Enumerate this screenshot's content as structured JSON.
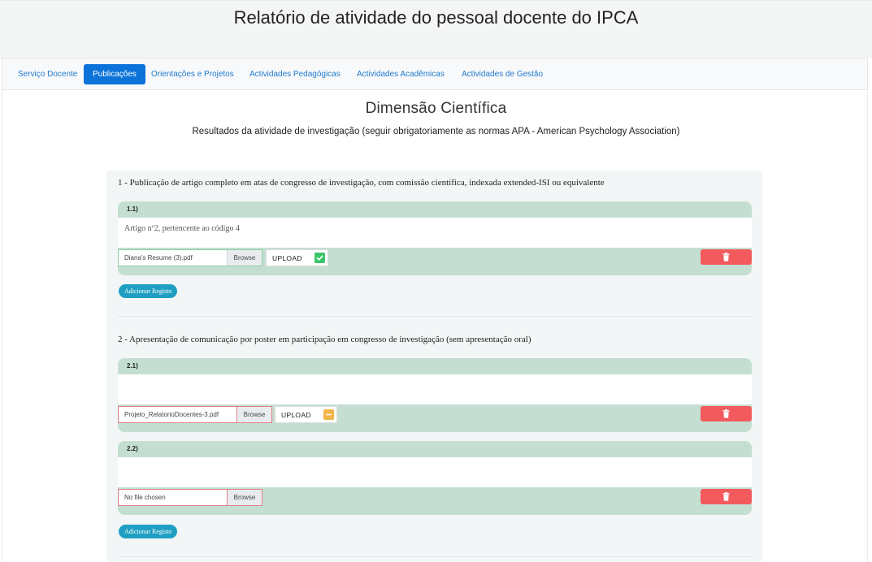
{
  "header": {
    "title": "Relatório de atividade do pessoal docente do IPCA"
  },
  "nav": {
    "tabs": [
      {
        "label": "Serviço Docente"
      },
      {
        "label": "Publicações"
      },
      {
        "label": "Orientações e Projetos"
      },
      {
        "label": "Actividades Pedagógicas"
      },
      {
        "label": "Actividades Acadêmicas"
      },
      {
        "label": "Actividades de Gestão"
      }
    ],
    "active_tab": "Publicações"
  },
  "main": {
    "title": "Dimensão Científica",
    "subtitle": "Resultados da atividade de investigação (seguir obrigatoriamente as normas APA - American Psychology Association)"
  },
  "sections": [
    {
      "title": "1 - Publicação de artigo completo em atas de congresso de investigação, com comissão científica, indexada extended-ISI ou equivalente",
      "records": [
        {
          "label": "1.1)",
          "text": "Artigo nº2, pertencente ao código 4",
          "file": "Diana's Resume (3).pdf",
          "browse": "Browse",
          "upload": "UPLOAD",
          "status": "success"
        }
      ],
      "add_label": "Adicionar Registo"
    },
    {
      "title": "2 - Apresentação de comunicação por poster em participação em congresso de investigação (sem apresentação oral)",
      "records": [
        {
          "label": "2.1)",
          "text": "",
          "file": "Projeto_RelatorioDocentes-3.pdf",
          "browse": "Browse",
          "upload": "UPLOAD",
          "status": "pending"
        },
        {
          "label": "2.2)",
          "text": "",
          "file": "No file chosen",
          "browse": "Browse"
        }
      ],
      "add_label": "Adicionar Registo"
    }
  ],
  "colors": {
    "accent": "#0b73d9",
    "record_bg": "#c4dfd2",
    "delete": "#f35a5e",
    "success": "#3cc46b",
    "pending": "#f2b54a",
    "add_button": "#1e9fc3"
  }
}
